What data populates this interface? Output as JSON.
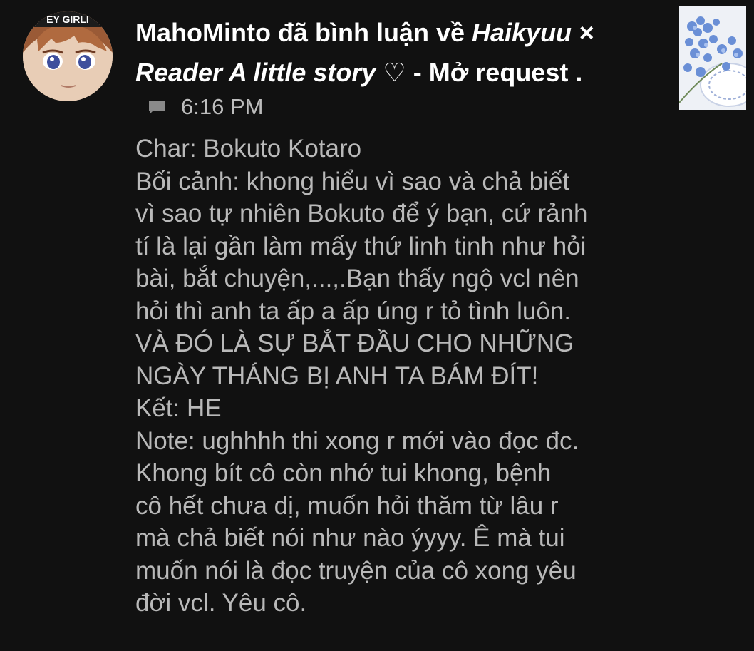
{
  "notification": {
    "username": "MahoMinto",
    "action_text": " đã bình luận về ",
    "story_title": "Haikyuu × Reader A little story ♡ - Mở request",
    "story_title_line1": "Haikyuu ×",
    "story_title_line2": "Reader A little story ♡",
    "trailing_text": " - Mở request .",
    "time": "6:16 PM",
    "avatar_badge_text": "EY GIRLI",
    "comment_icon": "comment-icon"
  },
  "comment": {
    "lines": [
      "Char: Bokuto Kotaro",
      "Bối cảnh: khong hiểu vì sao và chả biết",
      "vì sao tự nhiên Bokuto để ý bạn, cứ rảnh",
      "tí là lại gần làm mấy thứ linh tinh như hỏi",
      "bài, bắt chuyện,...,.Bạn thấy ngộ vcl nên",
      "hỏi thì anh ta ấp a ấp úng r tỏ tình luôn.",
      "VÀ ĐÓ LÀ SỰ BẮT ĐẦU CHO NHỮNG",
      "NGÀY THÁNG BỊ ANH TA BÁM ĐÍT!",
      "Kết: HE",
      "Note: ughhhh thi xong r mới vào đọc đc.",
      "Khong bít cô còn nhớ tui khong, bệnh",
      "cô hết chưa dị, muốn hỏi thăm từ lâu r",
      "mà chả biết nói như nào ýyyy. Ê mà tui",
      "muốn nói là đọc truyện của cô xong yêu",
      "đời vcl. Yêu cô."
    ]
  },
  "colors": {
    "background": "#111111",
    "title_text": "#ffffff",
    "comment_text": "#b9b9b9",
    "meta_text": "#bdbdbd"
  }
}
